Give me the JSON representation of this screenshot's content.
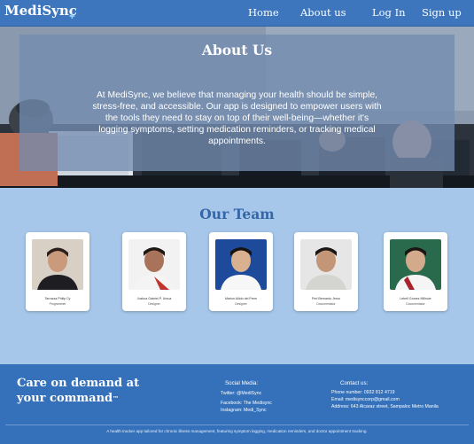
{
  "header": {
    "logo": "MediSync",
    "nav": [
      "Home",
      "About us",
      "Log In",
      "Sign up"
    ]
  },
  "about": {
    "title": "About Us",
    "text": "At MediSync, we believe that managing your health should be simple, stress-free, and accessible. Our app is designed to empower users with the tools they need to stay on top of their well-being—whether it's logging symptoms, setting medication reminders, or tracking medical appointments."
  },
  "team": {
    "title": "Our Team",
    "members": [
      {
        "name": "Tarrazza Philip Cy",
        "role": "Programmer"
      },
      {
        "name": "Joshua Gabriel P. Ursua",
        "role": "Designer"
      },
      {
        "name": "Marion Allido del Prem",
        "role": "Designer"
      },
      {
        "name": "Ped Bernardo Jerus",
        "role": "Documentator"
      },
      {
        "name": "Lebell Gomez Millnuie",
        "role": "Documentator"
      }
    ]
  },
  "footer": {
    "tagline": "Care on demand at your command",
    "tm": "™",
    "social_heading": "Social Media:",
    "twitter": "Twitter: @MediSync",
    "facebook": "Facebook: The Medisync",
    "instagram": "Instagram: Medi_Sync",
    "contact_heading": "Contact us:",
    "phone": "Phone number: 0932 812 4719",
    "email": "Email: medisynccorp@gmail.com",
    "address": "Address: 643 Alcaraz street, Sampaloc Metro Manila",
    "copyright": "A health tracker app tailored for chronic illness management, featuring symptom logging, medication reminders, and doctor appointment tracking."
  },
  "colors": {
    "primary": "#3d76bd",
    "background": "#a6c7ea",
    "team_title": "#3566a6",
    "footer": "#3471ba"
  }
}
